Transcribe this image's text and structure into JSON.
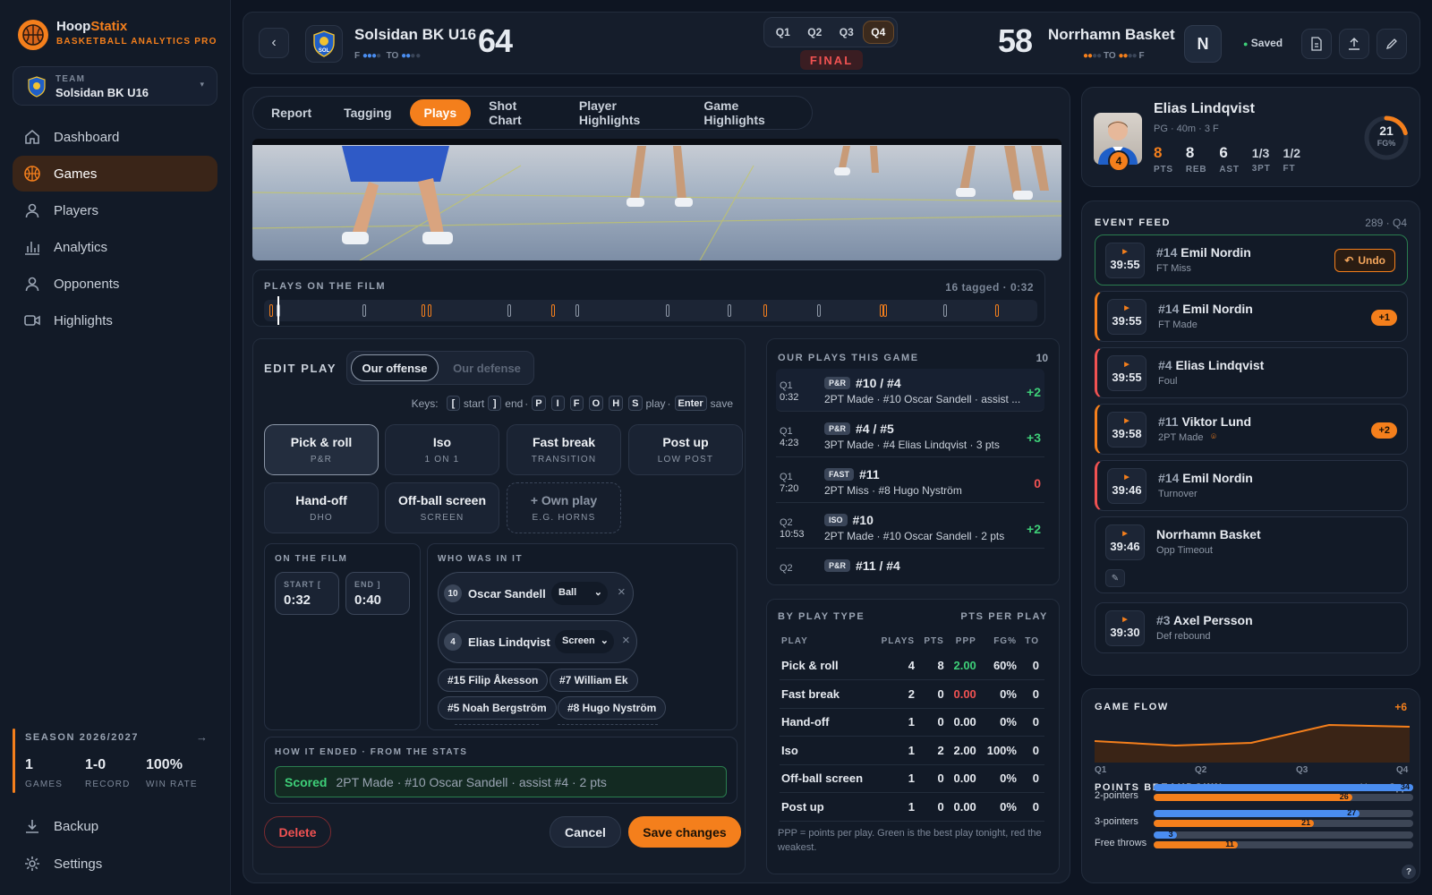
{
  "app": {
    "name_part1": "Hoop",
    "name_part2": "Statix",
    "tagline": "BASKETBALL ANALYTICS PRO"
  },
  "team_selector": {
    "label": "TEAM",
    "value": "Solsidan BK U16"
  },
  "nav": [
    {
      "label": "Dashboard",
      "icon": "home-icon"
    },
    {
      "label": "Games",
      "icon": "basketball-icon"
    },
    {
      "label": "Players",
      "icon": "person-icon"
    },
    {
      "label": "Analytics",
      "icon": "bar-chart-icon"
    },
    {
      "label": "Opponents",
      "icon": "person-icon"
    },
    {
      "label": "Highlights",
      "icon": "video-icon"
    }
  ],
  "season": {
    "title": "SEASON 2026/2027",
    "games": "1",
    "games_label": "GAMES",
    "record": "1-0",
    "record_label": "RECORD",
    "win_rate": "100%",
    "win_rate_label": "WIN RATE"
  },
  "footer_nav": [
    {
      "label": "Backup",
      "icon": "download-icon"
    },
    {
      "label": "Settings",
      "icon": "gear-icon"
    }
  ],
  "scoreboard": {
    "home": {
      "name": "Solsidan BK U16",
      "score": "64",
      "badge": "SOL",
      "fouls_label": "F",
      "to_label": "TO"
    },
    "away": {
      "name": "Norrhamn Basket",
      "score": "58",
      "badge": "N",
      "fouls_label": "F",
      "to_label": "TO"
    },
    "quarters": [
      "Q1",
      "Q2",
      "Q3",
      "Q4"
    ],
    "active_quarter": "Q4",
    "status": "FINAL",
    "saved_label": "Saved"
  },
  "tabs": [
    "Report",
    "Tagging",
    "Plays",
    "Shot Chart",
    "Player Highlights",
    "Game Highlights"
  ],
  "active_tab": "Plays",
  "film_timeline": {
    "title": "PLAYS ON THE FILM",
    "meta": "16 tagged · 0:32"
  },
  "edit_play": {
    "title": "EDIT PLAY",
    "toggle": [
      "Our offense",
      "Our defense"
    ],
    "keys": {
      "label": "Keys:",
      "k1": "[",
      "t1": "start",
      "k2": "]",
      "t2": "end",
      "letters": [
        "P",
        "I",
        "F",
        "O",
        "H",
        "S"
      ],
      "t3": "play",
      "k3": "Enter",
      "t4": "save"
    },
    "play_types": [
      {
        "name": "Pick & roll",
        "sub": "P&R"
      },
      {
        "name": "Iso",
        "sub": "1 ON 1"
      },
      {
        "name": "Fast break",
        "sub": "TRANSITION"
      },
      {
        "name": "Post up",
        "sub": "LOW POST"
      },
      {
        "name": "Hand-off",
        "sub": "DHO"
      },
      {
        "name": "Off-ball screen",
        "sub": "SCREEN"
      },
      {
        "name": "+ Own play",
        "sub": "E.G. HORNS"
      }
    ],
    "on_film": {
      "title": "ON THE FILM",
      "start_label": "START [",
      "start": "0:32",
      "end_label": "END ]",
      "end": "0:40"
    },
    "who": {
      "title": "WHO WAS IN IT",
      "selected": [
        {
          "num": "10",
          "name": "Oscar Sandell",
          "role": "Ball"
        },
        {
          "num": "4",
          "name": "Elias Lindqvist",
          "role": "Screen"
        }
      ],
      "others": [
        "#15 Filip Åkesson",
        "#7 William Ek",
        "#5 Noah Bergström",
        "#8 Hugo Nyström"
      ]
    },
    "ended": {
      "title": "HOW IT ENDED · FROM THE STATS",
      "result": "Scored",
      "detail": "2PT Made · #10 Oscar Sandell · assist #4 · 2 pts"
    },
    "buttons": {
      "delete": "Delete",
      "cancel": "Cancel",
      "save": "Save changes"
    }
  },
  "our_plays": {
    "title": "OUR PLAYS THIS GAME",
    "count": "10",
    "items": [
      {
        "q": "Q1",
        "t": "0:32",
        "tag": "P&R",
        "players": "#10 / #4",
        "desc": "2PT Made · #10 Oscar Sandell · assist ...",
        "pts": "+2"
      },
      {
        "q": "Q1",
        "t": "4:23",
        "tag": "P&R",
        "players": "#4 / #5",
        "desc": "3PT Made · #4 Elias Lindqvist · 3 pts",
        "pts": "+3"
      },
      {
        "q": "Q1",
        "t": "7:20",
        "tag": "FAST",
        "players": "#11",
        "desc": "2PT Miss · #8 Hugo Nyström",
        "pts": "0"
      },
      {
        "q": "Q2",
        "t": "10:53",
        "tag": "ISO",
        "players": "#10",
        "desc": "2PT Made · #10 Oscar Sandell · 2 pts",
        "pts": "+2"
      },
      {
        "q": "Q2",
        "t": "",
        "tag": "P&R",
        "players": "#11 / #4",
        "desc": "",
        "pts": ""
      }
    ]
  },
  "by_play_type": {
    "title": "BY PLAY TYPE",
    "subtitle": "PTS PER PLAY",
    "columns": [
      "PLAY",
      "PLAYS",
      "PTS",
      "PPP",
      "FG%",
      "TO"
    ],
    "rows": [
      [
        "Pick & roll",
        "4",
        "8",
        "2.00",
        "60%",
        "0"
      ],
      [
        "Fast break",
        "2",
        "0",
        "0.00",
        "0%",
        "0"
      ],
      [
        "Hand-off",
        "1",
        "0",
        "0.00",
        "0%",
        "0"
      ],
      [
        "Iso",
        "1",
        "2",
        "2.00",
        "100%",
        "0"
      ],
      [
        "Off-ball screen",
        "1",
        "0",
        "0.00",
        "0%",
        "0"
      ],
      [
        "Post up",
        "1",
        "0",
        "0.00",
        "0%",
        "0"
      ]
    ],
    "footnote": "PPP = points per play. Green is the best play tonight, red the weakest."
  },
  "player_card": {
    "name": "Elias Lindqvist",
    "meta": "PG · 40m · 3 F",
    "number": "4",
    "stats": [
      {
        "v": "8",
        "l": "PTS"
      },
      {
        "v": "8",
        "l": "REB"
      },
      {
        "v": "6",
        "l": "AST"
      },
      {
        "v": "1/3",
        "l": "3PT"
      },
      {
        "v": "1/2",
        "l": "FT"
      }
    ],
    "fg_value": "21",
    "fg_label": "FG%",
    "fg_fraction": 0.21
  },
  "event_feed": {
    "title": "EVENT FEED",
    "meta": "289 · Q4",
    "items": [
      {
        "time": "39:55",
        "name_num": "#14",
        "name": "Emil Nordin",
        "desc": "FT Miss",
        "badge": "",
        "action": "Undo"
      },
      {
        "time": "39:55",
        "name_num": "#14",
        "name": "Emil Nordin",
        "desc": "FT Made",
        "badge": "+1",
        "action": ""
      },
      {
        "time": "39:55",
        "name_num": "#4",
        "name": "Elias Lindqvist",
        "desc": "Foul",
        "badge": "",
        "action": ""
      },
      {
        "time": "39:58",
        "name_num": "#11",
        "name": "Viktor Lund",
        "desc": "2PT Made",
        "badge": "+2",
        "action": ""
      },
      {
        "time": "39:46",
        "name_num": "#14",
        "name": "Emil Nordin",
        "desc": "Turnover",
        "badge": "",
        "action": ""
      },
      {
        "time": "39:46",
        "name_num": "",
        "name": "Norrhamn Basket",
        "desc": "Opp Timeout",
        "badge": "",
        "action": ""
      },
      {
        "time": "39:30",
        "name_num": "#3",
        "name": "Axel Persson",
        "desc": "Def rebound",
        "badge": "",
        "action": ""
      }
    ]
  },
  "game_flow": {
    "title": "GAME FLOW",
    "value": "+6",
    "labels": [
      "Q1",
      "Q2",
      "Q3",
      "Q4"
    ]
  },
  "chart_data": {
    "type": "bar",
    "title": "POINTS BREAKDOWN",
    "categories": [
      "2-pointers",
      "3-pointers",
      "Free throws"
    ],
    "series": [
      {
        "name": "Us",
        "values": [
          34,
          27,
          3
        ],
        "color": "#4a8df0"
      },
      {
        "name": "Opp",
        "values": [
          26,
          21,
          11
        ],
        "color": "#f47f1c"
      }
    ],
    "legend": "top-right"
  },
  "colors": {
    "accent": "#f47f1c",
    "us": "#4a8df0",
    "good": "#3ecf78",
    "bad": "#f05252"
  }
}
